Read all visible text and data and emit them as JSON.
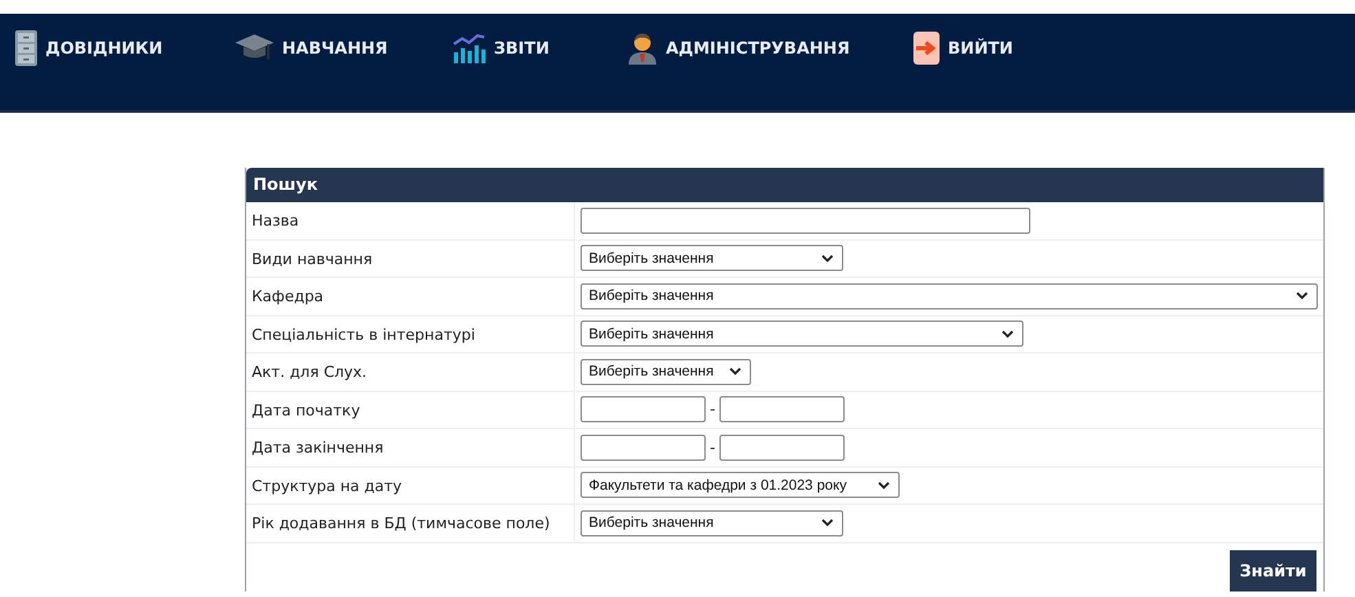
{
  "nav": [
    {
      "label": "ДОВІДНИКИ"
    },
    {
      "label": "НАВЧАННЯ"
    },
    {
      "label": "ЗВІТИ"
    },
    {
      "label": "АДМІНІСТРУВАННЯ"
    },
    {
      "label": "ВИЙТИ"
    }
  ],
  "search_panel": {
    "title": "Пошук",
    "fields": [
      {
        "label": "Назва",
        "kind": "text"
      },
      {
        "label": "Види навчання",
        "kind": "select",
        "value": "Виберіть значення"
      },
      {
        "label": "Кафедра",
        "kind": "select",
        "value": "Виберіть значення"
      },
      {
        "label": "Спеціальність в інтернатурі",
        "kind": "select",
        "value": "Виберіть значення"
      },
      {
        "label": "Акт. для Слух.",
        "kind": "select",
        "value": "Виберіть значення"
      },
      {
        "label": "Дата початку",
        "kind": "date_range",
        "separator": "-"
      },
      {
        "label": "Дата закінчення",
        "kind": "date_range",
        "separator": "-"
      },
      {
        "label": "Структура на дату",
        "kind": "select",
        "value": "Факультети та кафедри з 01.2023 року"
      },
      {
        "label": "Рік додавання в БД (тимчасове поле)",
        "kind": "select",
        "value": "Виберіть значення"
      }
    ],
    "button": "Знайти"
  }
}
